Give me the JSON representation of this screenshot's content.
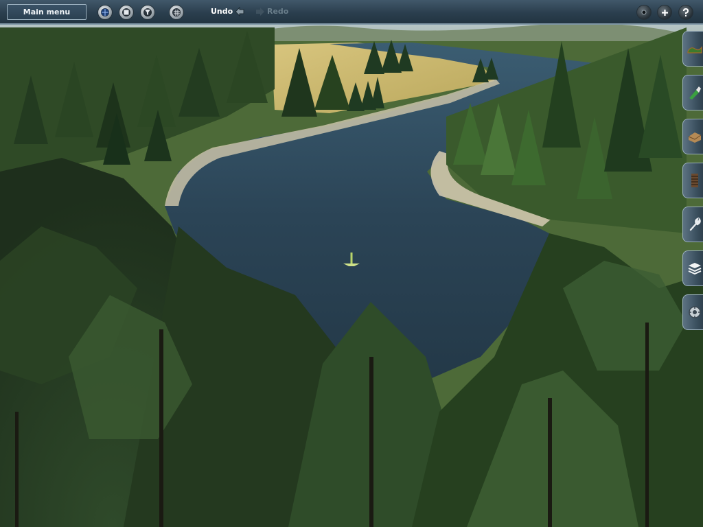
{
  "toolbar": {
    "main_menu_label": "Main menu",
    "left_buttons": [
      "globe-icon",
      "stop-icon",
      "filter-icon",
      "grid-icon"
    ],
    "undo_label": "Undo",
    "redo_label": "Redo",
    "right_buttons": [
      "camera-icon",
      "zoom-in-icon",
      "help-icon"
    ]
  },
  "side_tabs": [
    "terrain-tool",
    "paint-tool",
    "objects-tool",
    "track-tool",
    "wrench-tool",
    "layers-tool",
    "settings-tool"
  ],
  "colors": {
    "toolbar": "#2b3f4e",
    "water": "#283e4d",
    "forest": "#2c3e28",
    "field": "#c9b46c"
  }
}
